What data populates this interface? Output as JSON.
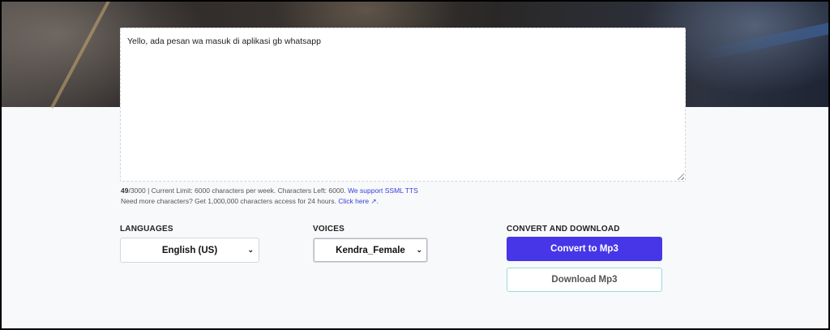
{
  "editor": {
    "text": "Yello, ada pesan wa masuk di aplikasi gb whatsapp"
  },
  "info": {
    "count": "49",
    "count_rest": "/3000 | Current Limit: 6000 characters per week. Characters Left: 6000.",
    "ssml_link": "We support SSML TTS",
    "more_text": "Need more characters? Get 1,000,000 characters access for 24 hours.",
    "click_here": "Click here ↗."
  },
  "languages": {
    "label": "LANGUAGES",
    "selected": "English (US)"
  },
  "voices": {
    "label": "VOICES",
    "selected": "Kendra_Female"
  },
  "convert": {
    "label": "CONVERT AND DOWNLOAD",
    "convert_button": "Convert to Mp3",
    "download_button": "Download Mp3"
  },
  "colors": {
    "primary": "#4636e8",
    "link": "#3b3fd8",
    "secondary_border": "#9fd8dc"
  }
}
